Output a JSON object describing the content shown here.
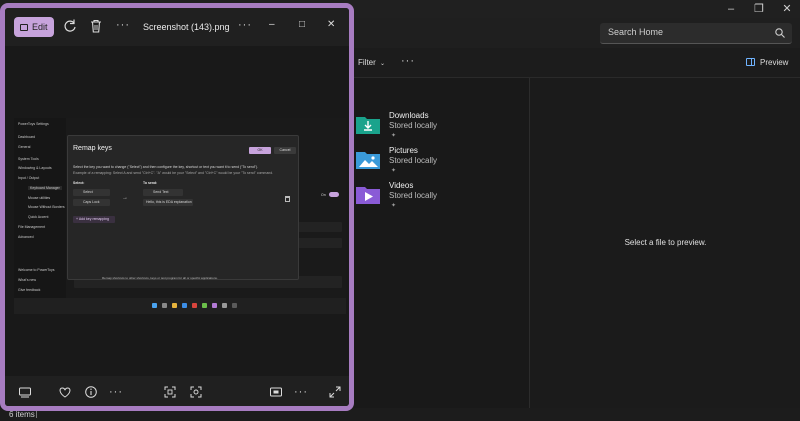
{
  "explorer": {
    "search_placeholder": "Search Home",
    "toolbar": {
      "filter_label": "Filter",
      "preview_label": "Preview"
    },
    "items": [
      {
        "name": "Downloads",
        "status": "Stored locally",
        "icon": "downloads-folder-icon",
        "color": "#1aa38c"
      },
      {
        "name": "Pictures",
        "status": "Stored locally",
        "icon": "pictures-folder-icon",
        "color": "#3a9ad9"
      },
      {
        "name": "Videos",
        "status": "Stored locally",
        "icon": "videos-folder-icon",
        "color": "#8a5bd6"
      }
    ],
    "preview_message": "Select a file to preview.",
    "status_count": "6 items"
  },
  "photos": {
    "edit_label": "Edit",
    "title": "Screenshot (143).png",
    "accent": "#c7a3dc",
    "frame_color": "#a77cc1",
    "screenshot": {
      "sidebar_items": [
        "PowerToys Settings",
        "Dashboard",
        "General",
        "System Tools",
        "Windowing & Layouts",
        "Input / Output",
        "Keyboard Manager",
        "Mouse utilities",
        "Mouse Without Borders",
        "Quick Accent",
        "File Management",
        "Advanced",
        "Welcome to PowerToys",
        "What's new",
        "Give feedback"
      ],
      "dialog": {
        "title": "Remap keys",
        "ok": "OK",
        "cancel": "Cancel",
        "desc1": "Select the key you want to change (\"Select\") and then configure the key, shortcut or text you want it to send (\"To send\").",
        "desc2": "Example of a remapping: Select A and send \"Ctrl+C\". \"A\" would be your \"Select\" and \"Ctrl+C\" would be your \"To send\" command.",
        "select_label": "Select:",
        "send_label": "To send:",
        "select_keys": [
          "Select",
          "Caps Lock"
        ],
        "send_keys": [
          "Send Text",
          "Hello, this is EDA explanation"
        ],
        "add_label": "Add key remapping"
      },
      "toggle_label": "On",
      "footer_text": "Remap shortcuts to other shortcuts, keys or text program for all or specific applications."
    }
  }
}
